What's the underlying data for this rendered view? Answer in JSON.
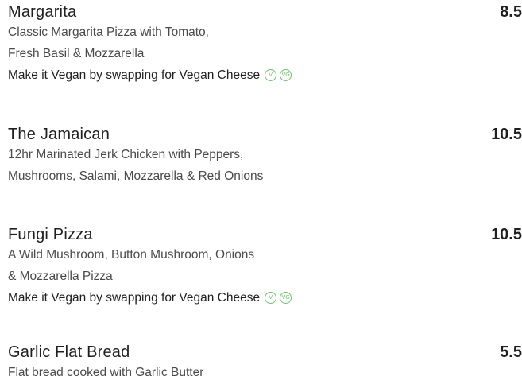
{
  "items": [
    {
      "name": "Margarita",
      "price": "8.5",
      "description_lines": [
        "Classic Margarita Pizza with Tomato,",
        "Fresh Basil & Mozzarella"
      ],
      "vegan_note": "Make it Vegan by swapping for Vegan Cheese",
      "badges": [
        "V",
        "VG"
      ]
    },
    {
      "name": "The Jamaican",
      "price": "10.5",
      "description_lines": [
        "12hr Marinated Jerk Chicken with Peppers,",
        "Mushrooms, Salami, Mozzarella & Red Onions"
      ]
    },
    {
      "name": "Fungi Pizza",
      "price": "10.5",
      "description_lines": [
        "A Wild Mushroom, Button Mushroom, Onions",
        "& Mozzarella Pizza"
      ],
      "vegan_note": "Make it Vegan by swapping for Vegan Cheese",
      "badges": [
        "V",
        "VG"
      ]
    },
    {
      "name": "Garlic Flat Bread",
      "price": "5.5",
      "description_lines": [
        "Flat bread cooked with Garlic Butter"
      ]
    }
  ],
  "colors": {
    "badge": "#6cc36c",
    "text": "#1f1f1f",
    "muted": "#4a4a4a"
  }
}
